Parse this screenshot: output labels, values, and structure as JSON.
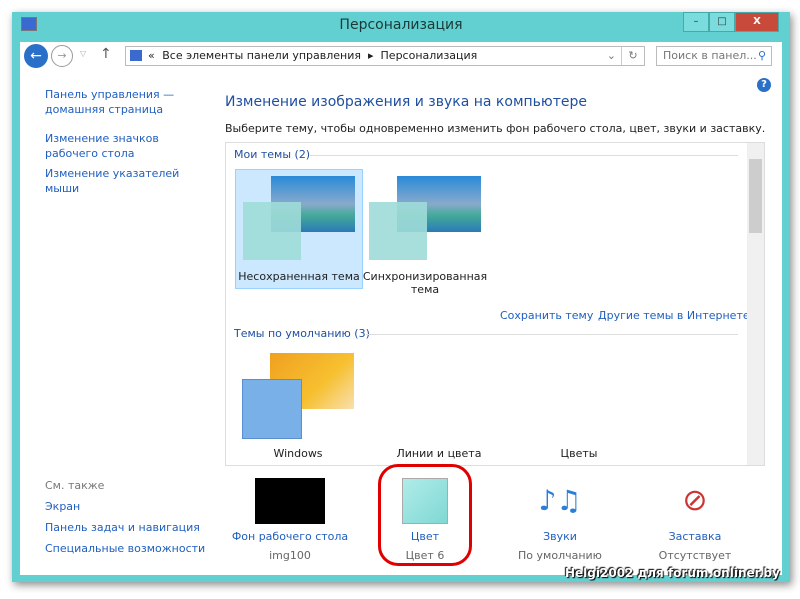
{
  "window": {
    "title": "Персонализация"
  },
  "address": {
    "path_prefix": "«",
    "crumb1": "Все элементы панели управления",
    "crumb2": "Персонализация",
    "search_placeholder": "Поиск в панел..."
  },
  "nav": {
    "home": "Панель управления — домашняя страница",
    "icons": "Изменение значков рабочего стола",
    "pointers": "Изменение указателей мыши",
    "see_also": "См. также",
    "display": "Экран",
    "taskbar": "Панель задач и навигация",
    "access": "Специальные возможности"
  },
  "main": {
    "heading": "Изменение изображения и звука на компьютере",
    "desc": "Выберите тему, чтобы одновременно изменить фон рабочего стола, цвет, звуки и заставку.",
    "my_themes": "Мои темы (2)",
    "theme1": "Несохраненная тема",
    "theme2": "Синхронизированная тема",
    "save": "Сохранить тему",
    "more": "Другие темы в Интернете",
    "default_themes": "Темы по умолчанию (3)",
    "d1": "Windows",
    "d2": "Линии и цвета",
    "d3": "Цветы"
  },
  "bottom": [
    {
      "label": "Фон рабочего стола",
      "value": "img100"
    },
    {
      "label": "Цвет",
      "value": "Цвет 6"
    },
    {
      "label": "Звуки",
      "value": "По умолчанию"
    },
    {
      "label": "Заставка",
      "value": "Отсутствует"
    }
  ],
  "watermark": "Helgi2002 для forum.onliner.by",
  "colors": {
    "frame": "#62d0d0",
    "link": "#1f5fbf",
    "highlight": "#e00000"
  }
}
